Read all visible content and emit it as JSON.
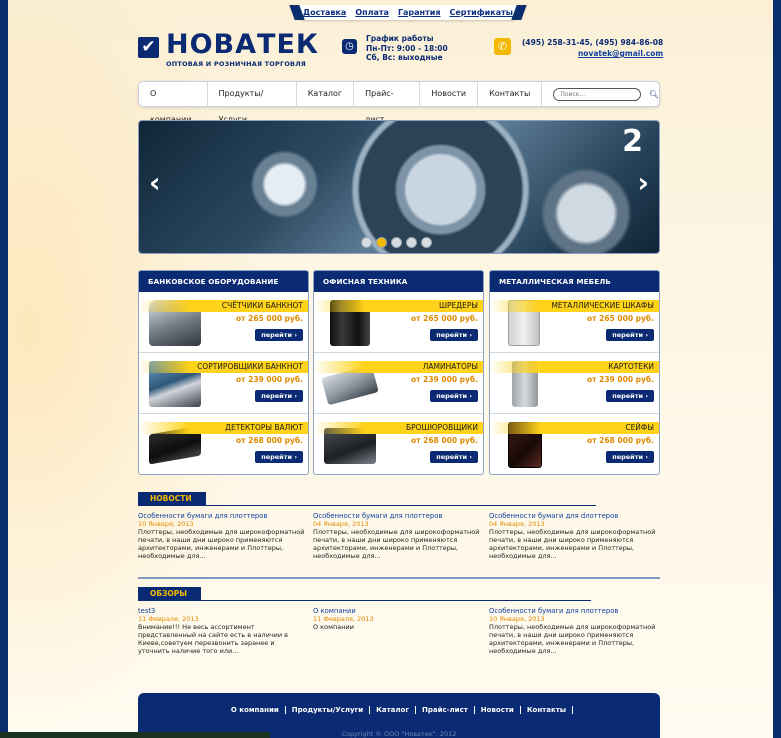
{
  "toplinks": [
    "Доставка",
    "Оплата",
    "Гарантия",
    "Сертификаты"
  ],
  "logo": {
    "title": "НОВАТЕК",
    "subtitle": "ОПТОВАЯ И РОЗНИЧНАЯ ТОРГОВЛЯ"
  },
  "hours": {
    "title": "График работы",
    "line1": "Пн-Пт: 9:00 - 18:00",
    "line2": "Сб, Вс: выходные"
  },
  "contact": {
    "phones": "(495) 258-31-45, (495) 984-86-08",
    "email": "novatek@gmail.com"
  },
  "nav": [
    "О компании",
    "Продукты/Услуги",
    "Каталог",
    "Прайс-лист",
    "Новости",
    "Контакты"
  ],
  "search": {
    "placeholder": "Поиск..."
  },
  "banner": {
    "prev": "‹",
    "next": "›",
    "number": "2",
    "dots": 5,
    "active_dot": 2
  },
  "categories": [
    {
      "name": "БАНКОВСКОЕ ОБОРУДОВАНИЕ",
      "items": [
        {
          "title": "СЧЁТЧИКИ БАНКНОТ",
          "price": "от 265 000 руб.",
          "button": "перейти ›",
          "icon": "banknote-counter"
        },
        {
          "title": "СОРТИРОВЩИКИ БАНКНОТ",
          "price": "от 239 000 руб.",
          "button": "перейти ›",
          "icon": "banknote-sorter"
        },
        {
          "title": "ДЕТЕКТОРЫ ВАЛЮТ",
          "price": "от 268 000 руб.",
          "button": "перейти ›",
          "icon": "currency-detector"
        }
      ]
    },
    {
      "name": "ОФИСНАЯ ТЕХНИКА",
      "items": [
        {
          "title": "ШРЕДЕРЫ",
          "price": "от 265 000 руб.",
          "button": "перейти ›",
          "icon": "shredder"
        },
        {
          "title": "ЛАМИНАТОРЫ",
          "price": "от 239 000 руб.",
          "button": "перейти ›",
          "icon": "laminator"
        },
        {
          "title": "БРОШЮРОВЩИКИ",
          "price": "от 268 000 руб.",
          "button": "перейти ›",
          "icon": "binder"
        }
      ]
    },
    {
      "name": "МЕТАЛЛИЧЕСКАЯ МЕБЕЛЬ",
      "items": [
        {
          "title": "МЕТАЛЛИЧЕСКИЕ ШКАФЫ",
          "price": "от 265 000 руб.",
          "button": "перейти ›",
          "icon": "metal-cabinet"
        },
        {
          "title": "КАРТОТЕКИ",
          "price": "от 239 000 руб.",
          "button": "перейти ›",
          "icon": "file-cabinet"
        },
        {
          "title": "СЕЙФЫ",
          "price": "от 268 000 руб.",
          "button": "перейти ›",
          "icon": "safe"
        }
      ]
    }
  ],
  "news": {
    "heading": "НОВОСТИ",
    "items": [
      {
        "title": "Особенности бумаги для плоттеров",
        "date": "10 Января, 2013",
        "text": "Плоттеры, необходимые для широкоформатной печати, в наши дни широко применяются архитекторами, инженерами и Плоттеры, необходимые для..."
      },
      {
        "title": "Особенности бумаги для плоттеров",
        "date": "04 Января, 2013",
        "text": "Плоттеры, необходимые для широкоформатной печати, в наши дни широко применяются архитекторами, инженерами и Плоттеры, необходимые для..."
      },
      {
        "title": "Особенности бумаги для dлоттеров",
        "date": "04 Января, 2013",
        "text": "Плоттеры, необходимые для широкоформатной печати, в наши дни широко применяются архитекторами, инженерами и Плоттеры, необходимые для..."
      }
    ]
  },
  "reviews": {
    "heading": "ОБЗОРЫ",
    "items": [
      {
        "title": "test3",
        "date": "11 Февраля, 2013",
        "text": "Внимание!!! Не весь ассортимент представленный на сайте есть в наличии в Киеве,советуем перезвонить заранее и уточнить наличие того или..."
      },
      {
        "title": "О компании",
        "date": "11 Февраля, 2013",
        "text": "О компании"
      },
      {
        "title": "Особенности бумаги для плоттеров",
        "date": "10 Января, 2013",
        "text": "Плоттеры, необходимые для широкоформатной печати, в наши дни широко применяются архитекторами, инженерами и Плоттеры, необходимые для..."
      }
    ]
  },
  "footer": {
    "nav": [
      "О компании",
      "Продукты/Услуги",
      "Каталог",
      "Прайс-лист",
      "Новости",
      "Контакты"
    ],
    "copyright": "Copyright © ООО \"Новатек\", 2012"
  },
  "colors": {
    "brand": "#0a2a73",
    "accent": "#f4b800",
    "price": "#e08a00"
  }
}
